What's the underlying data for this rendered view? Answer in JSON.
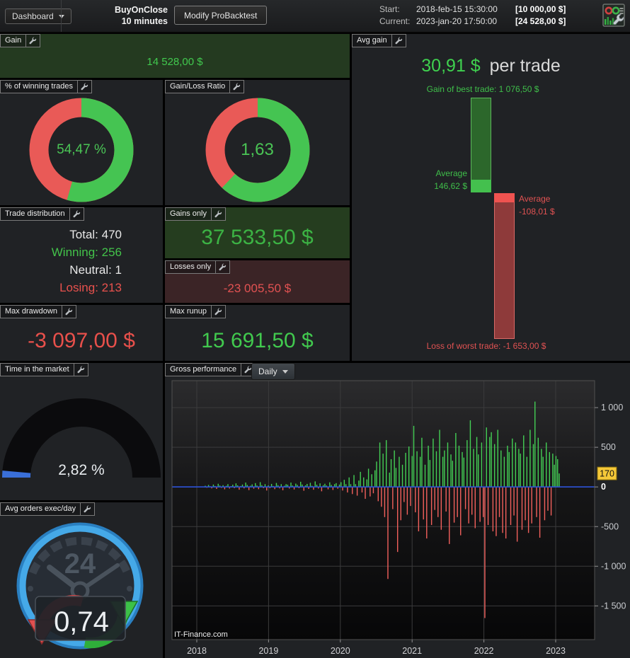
{
  "header": {
    "dashboard_label": "Dashboard",
    "instrument": "BuyOnClose",
    "timeframe": "10 minutes",
    "modify_button": "Modify ProBacktest",
    "start_label": "Start:",
    "start_datetime": "2018-feb-15 15:30:00",
    "start_value": "[10 000,00 $]",
    "current_label": "Current:",
    "current_datetime": "2023-jan-20 17:50:00",
    "current_value": "[24 528,00 $]"
  },
  "panels": {
    "gain": {
      "title": "Gain",
      "value": "14 528,00 $"
    },
    "winning_trades": {
      "title": "% of winning trades",
      "value": "54,47 %",
      "fraction": 0.5447
    },
    "gain_loss_ratio": {
      "title": "Gain/Loss Ratio",
      "value": "1,63",
      "fraction": 0.62
    },
    "avg_gain": {
      "title": "Avg gain",
      "value": "30,91 $",
      "suffix": "per trade",
      "best_label": "Gain of best trade: 1 076,50 $",
      "avg_win_label1": "Average",
      "avg_win_label2": "146,62 $",
      "avg_loss_label1": "Average",
      "avg_loss_label2": "-108,01 $",
      "worst_label": "Loss of worst trade: -1 653,00 $",
      "best": 1076.5,
      "avg_win": 146.62,
      "avg_loss": -108.01,
      "worst": -1653
    },
    "trade_distribution": {
      "title": "Trade distribution",
      "rows": [
        {
          "label": "Total:",
          "value": "470",
          "color": "#e8e8e8"
        },
        {
          "label": "Winning:",
          "value": "256",
          "color": "#43c24a"
        },
        {
          "label": "Neutral:",
          "value": "1",
          "color": "#e8e8e8"
        },
        {
          "label": "Losing:",
          "value": "213",
          "color": "#e8514d"
        }
      ]
    },
    "gains_only": {
      "title": "Gains only",
      "value": "37 533,50 $"
    },
    "losses_only": {
      "title": "Losses only",
      "value": "-23 005,50 $"
    },
    "max_drawdown": {
      "title": "Max drawdown",
      "value": "-3 097,00 $"
    },
    "max_runup": {
      "title": "Max runup",
      "value": "15 691,50 $"
    },
    "time_in_market": {
      "title": "Time in the market",
      "value": "2,82 %",
      "percent": 2.82
    },
    "avg_orders": {
      "title": "Avg orders exec/day",
      "value": "0,74",
      "dial_label": "24"
    },
    "gross_performance": {
      "title": "Gross performance",
      "period": "Daily"
    }
  },
  "watermark": "IT-Finance.com",
  "colors": {
    "green_text": "#41c94e",
    "red_text": "#e8504b",
    "donut_green": "#45c452",
    "donut_red": "#e95a57",
    "gauge_blue": "#3a6fd8"
  },
  "chart_data": {
    "type": "bar",
    "title": "Gross performance",
    "period": "Daily",
    "x_start": 2018.12,
    "x_end": 2023.05,
    "x_ticks": [
      2018,
      2019,
      2020,
      2021,
      2022,
      2023
    ],
    "y_ticks": [
      {
        "v": 1000,
        "label": "1 000"
      },
      {
        "v": 500,
        "label": "500"
      },
      {
        "v": 0,
        "label": "0"
      },
      {
        "v": -500,
        "label": "-500"
      },
      {
        "v": -1000,
        "label": "-1 000"
      },
      {
        "v": -1500,
        "label": "-1 500"
      }
    ],
    "ylim": [
      -1925,
      1340
    ],
    "grid": true,
    "current_value": 170,
    "current_value_label": "170",
    "up_color": "#44cf55",
    "down_color": "#f2605c",
    "zero_line_color": "#2d52d8",
    "badge_color": "#f5c838",
    "best_trade": 1076.5,
    "worst_trade": -1653,
    "values": [
      15,
      -10,
      25,
      8,
      -18,
      30,
      12,
      -25,
      40,
      18,
      -12,
      22,
      -30,
      14,
      35,
      -20,
      10,
      28,
      -15,
      45,
      20,
      -35,
      12,
      30,
      -18,
      55,
      25,
      -40,
      15,
      32,
      -22,
      48,
      18,
      -28,
      60,
      22,
      -15,
      35,
      -45,
      20,
      -15,
      38,
      12,
      -28,
      50,
      22,
      -18,
      35,
      -42,
      15,
      35,
      28,
      -20,
      55,
      18,
      -32,
      42,
      25,
      -15,
      65,
      30,
      -48,
      20,
      38,
      -25,
      52,
      15,
      -35,
      70,
      28,
      -20,
      45,
      -55,
      22,
      40,
      18,
      -30,
      58,
      25,
      -38,
      35,
      48,
      -22,
      30,
      60,
      -45,
      90,
      35,
      -70,
      120,
      35,
      -90,
      150,
      35,
      -110,
      80,
      190,
      -70,
      120,
      -150,
      95,
      230,
      -120,
      160,
      -80,
      210,
      320,
      -180,
      560,
      -250,
      420,
      -380,
      590,
      -1160,
      180,
      350,
      -280,
      460,
      240,
      -820,
      380,
      -420,
      280,
      -190,
      430,
      -350,
      510,
      -240,
      390,
      770,
      -320,
      450,
      -560,
      380,
      620,
      -410,
      280,
      -650,
      520,
      340,
      -480,
      610,
      -290,
      450,
      -380,
      720,
      -540,
      380,
      460,
      -310,
      560,
      -720,
      410,
      330,
      -450,
      680,
      -380,
      520,
      -610,
      440,
      370,
      -280,
      590,
      -460,
      840,
      -350,
      480,
      -520,
      630,
      410,
      -440,
      560,
      -380,
      -1653,
      750,
      -480,
      630,
      690,
      -560,
      540,
      -620,
      720,
      -380,
      460,
      -580,
      380,
      -650,
      520,
      440,
      -480,
      610,
      -360,
      560,
      -690,
      480,
      420,
      -540,
      650,
      -420,
      380,
      -580,
      720,
      -460,
      540,
      1076,
      -380,
      620,
      -640,
      480,
      380,
      -420,
      560,
      -300,
      440,
      -360,
      420,
      280,
      390,
      350,
      170
    ]
  }
}
